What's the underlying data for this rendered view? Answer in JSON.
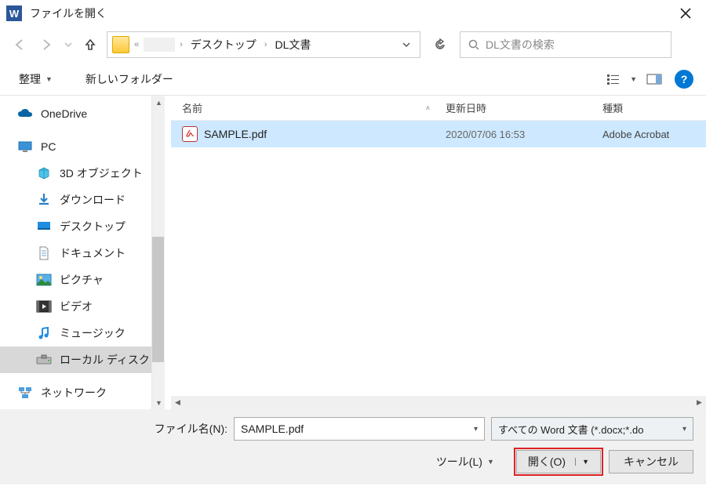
{
  "titlebar": {
    "title": "ファイルを開く"
  },
  "breadcrumb": {
    "chevrons": "«",
    "segments": [
      "デスクトップ",
      "DL文書"
    ]
  },
  "search": {
    "placeholder": "DL文書の検索"
  },
  "toolbar": {
    "organize": "整理",
    "new_folder": "新しいフォルダー"
  },
  "sidebar": {
    "items": [
      {
        "label": "OneDrive",
        "icon": "onedrive"
      },
      {
        "label": "PC",
        "icon": "pc"
      },
      {
        "label": "3D オブジェクト",
        "icon": "cube",
        "child": true
      },
      {
        "label": "ダウンロード",
        "icon": "download",
        "child": true
      },
      {
        "label": "デスクトップ",
        "icon": "desktop",
        "child": true
      },
      {
        "label": "ドキュメント",
        "icon": "document",
        "child": true
      },
      {
        "label": "ピクチャ",
        "icon": "pictures",
        "child": true
      },
      {
        "label": "ビデオ",
        "icon": "video",
        "child": true
      },
      {
        "label": "ミュージック",
        "icon": "music",
        "child": true
      },
      {
        "label": "ローカル ディスク (C",
        "icon": "disk",
        "child": true,
        "selected": true
      },
      {
        "label": "ネットワーク",
        "icon": "network"
      }
    ]
  },
  "columns": {
    "name": "名前",
    "date": "更新日時",
    "type": "種類"
  },
  "files": [
    {
      "name": "SAMPLE.pdf",
      "date": "2020/07/06 16:53",
      "type": "Adobe Acrobat"
    }
  ],
  "bottom": {
    "filename_label": "ファイル名(N):",
    "filename_value": "SAMPLE.pdf",
    "filetype": "すべての Word 文書 (*.docx;*.do",
    "tools": "ツール(L)",
    "open": "開く(O)",
    "cancel": "キャンセル"
  }
}
